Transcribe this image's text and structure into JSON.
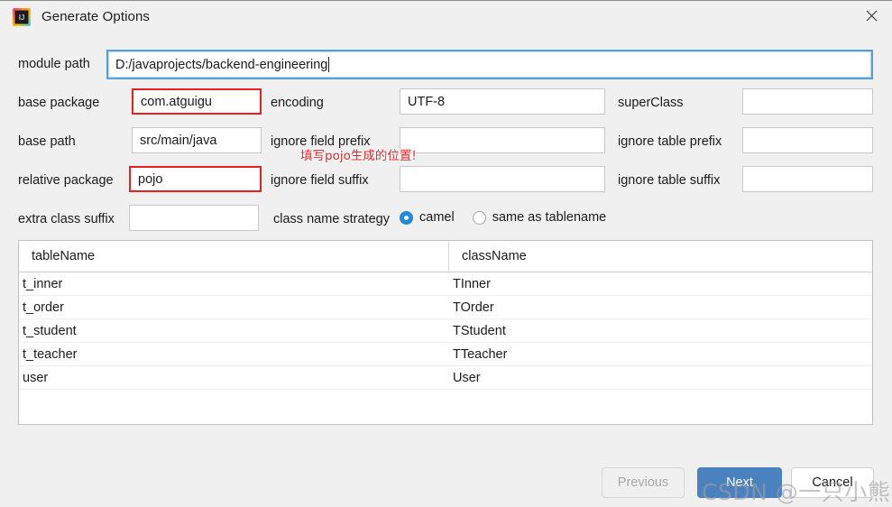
{
  "window": {
    "title": "Generate Options",
    "app_icon": "intellij-idea-icon",
    "close_icon": "close-icon"
  },
  "form": {
    "module_path": {
      "label": "module path",
      "value": "D:/javaprojects/backend-engineering"
    },
    "base_package": {
      "label": "base package",
      "value": "com.atguigu"
    },
    "base_path": {
      "label": "base path",
      "value": "src/main/java"
    },
    "relative_package": {
      "label": "relative package",
      "value": "pojo"
    },
    "extra_class_suffix": {
      "label": "extra class suffix",
      "value": ""
    },
    "encoding": {
      "label": "encoding",
      "value": "UTF-8"
    },
    "ignore_field_prefix": {
      "label": "ignore field prefix",
      "value": ""
    },
    "ignore_field_suffix": {
      "label": "ignore field suffix",
      "value": ""
    },
    "super_class": {
      "label": "superClass",
      "value": ""
    },
    "ignore_table_prefix": {
      "label": "ignore table prefix",
      "value": ""
    },
    "ignore_table_suffix": {
      "label": "ignore table suffix",
      "value": ""
    },
    "class_name_strategy": {
      "label": "class name strategy",
      "options": [
        "camel",
        "same as tablename"
      ],
      "selected": "camel"
    }
  },
  "annotation": {
    "text": "填写pojo生成的位置!",
    "color": "#e8201f"
  },
  "table": {
    "columns": [
      "tableName",
      "className"
    ],
    "rows": [
      {
        "tableName": "t_inner",
        "className": "TInner"
      },
      {
        "tableName": "t_order",
        "className": "TOrder"
      },
      {
        "tableName": "t_student",
        "className": "TStudent"
      },
      {
        "tableName": "t_teacher",
        "className": "TTeacher"
      },
      {
        "tableName": "user",
        "className": "User"
      }
    ]
  },
  "footer": {
    "previous": "Previous",
    "next": "Next",
    "cancel": "Cancel"
  },
  "watermark": {
    "text": "CSDN @一只小熊猫呀"
  },
  "colors": {
    "accent": "#4a81bf",
    "highlight": "#e8201f",
    "radio": "#1b8ce3",
    "background": "#f0f0f0"
  }
}
